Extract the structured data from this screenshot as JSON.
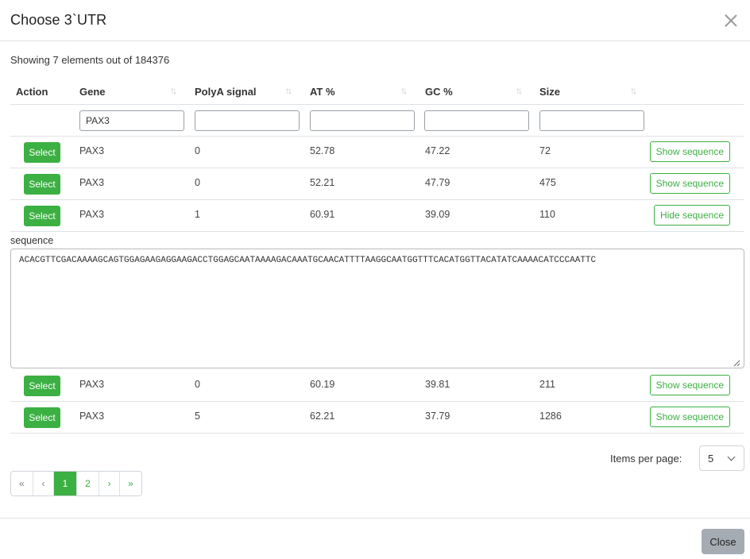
{
  "modal": {
    "title": "Choose 3`UTR",
    "close_label": "Close"
  },
  "summary": {
    "text": "Showing 7 elements out of 184376"
  },
  "table": {
    "headers": [
      "Action",
      "Gene",
      "PolyA signal",
      "AT %",
      "GC %",
      "Size"
    ],
    "filters": {
      "gene": "PAX3",
      "polya": "",
      "at": "",
      "gc": "",
      "size": ""
    },
    "select_label": "Select",
    "rows": [
      {
        "gene": "PAX3",
        "polya": "0",
        "at": "52.78",
        "gc": "47.22",
        "size": "72",
        "seq_button": "Show sequence"
      },
      {
        "gene": "PAX3",
        "polya": "0",
        "at": "52.21",
        "gc": "47.79",
        "size": "475",
        "seq_button": "Show sequence"
      },
      {
        "gene": "PAX3",
        "polya": "1",
        "at": "60.91",
        "gc": "39.09",
        "size": "110",
        "seq_button": "Hide sequence"
      },
      {
        "gene": "PAX3",
        "polya": "0",
        "at": "60.19",
        "gc": "39.81",
        "size": "211",
        "seq_button": "Show sequence"
      },
      {
        "gene": "PAX3",
        "polya": "5",
        "at": "62.21",
        "gc": "37.79",
        "size": "1286",
        "seq_button": "Show sequence"
      }
    ],
    "sequence": {
      "label": "sequence",
      "value": "ACACGTTCGACAAAAGCAGTGGAGAAGAGGAAGACCTGGAGCAATAAAAGACAAATGCAACATTTTAAGGCAATGGTTTCACATGGTTACATATCAAAACATCCCAATTC"
    }
  },
  "pagination": {
    "items_per_page_label": "Items per page:",
    "items_per_page_value": "5",
    "first": "«",
    "prev": "‹",
    "pages": [
      "1",
      "2"
    ],
    "next": "›",
    "last": "»",
    "current_page": "1"
  },
  "colors": {
    "accent": "#3cb043",
    "close_button": "#a5abb3"
  }
}
